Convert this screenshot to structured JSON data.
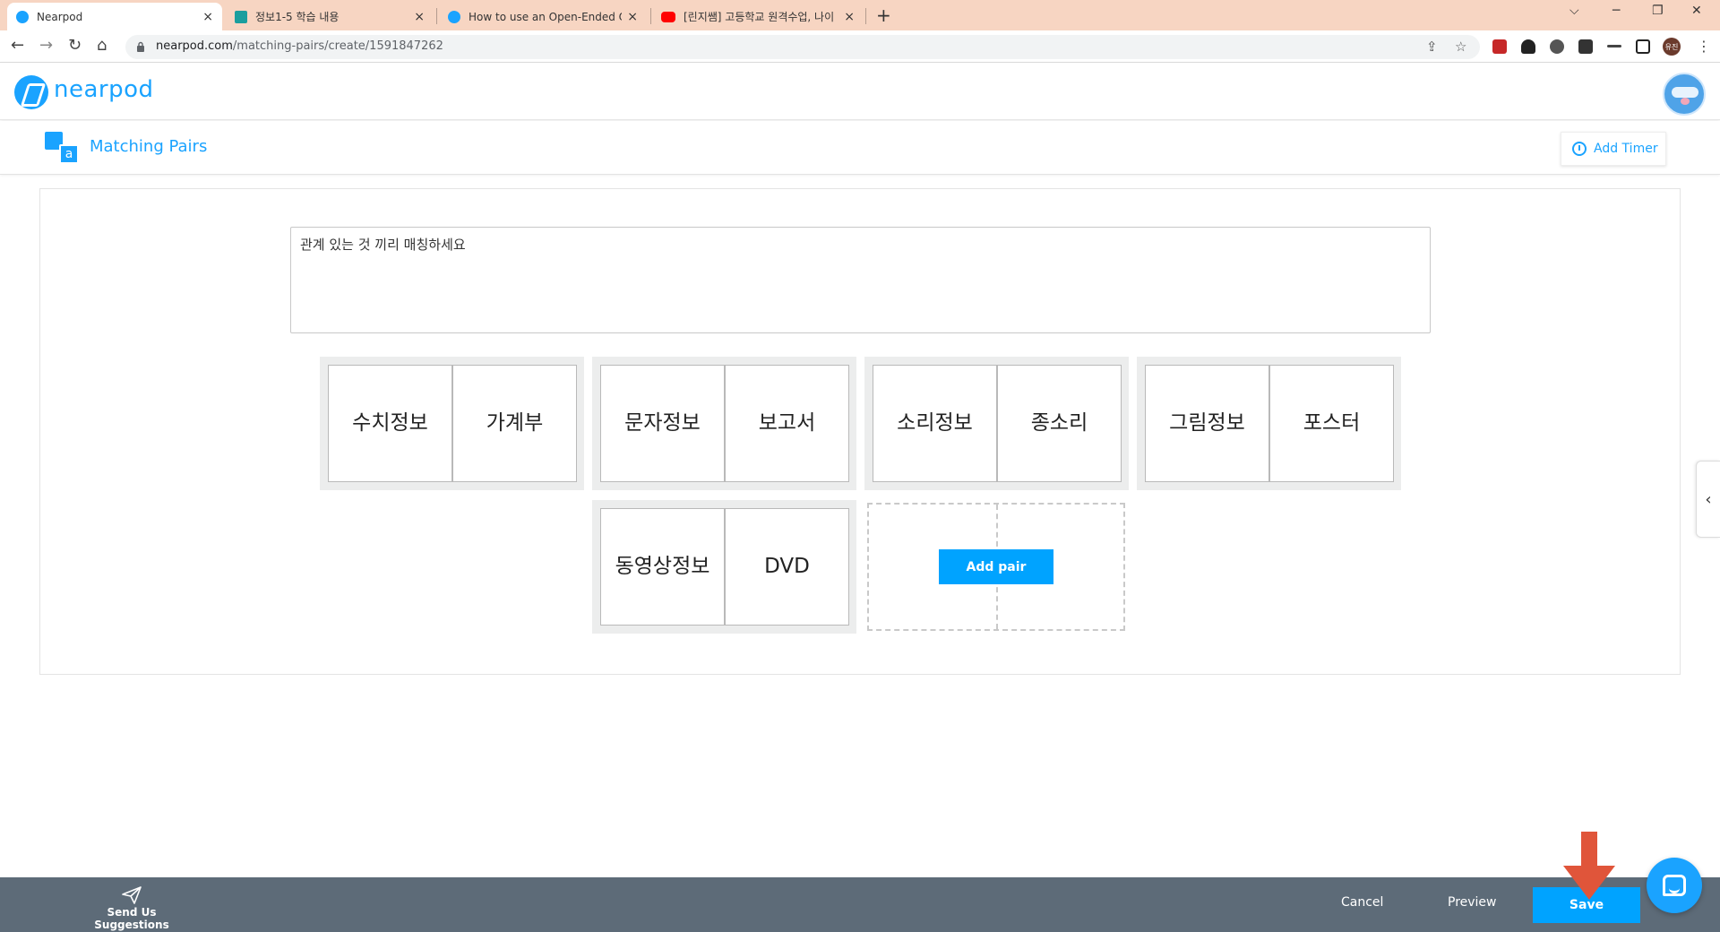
{
  "browser": {
    "tabs": [
      {
        "title": "Nearpod",
        "close": "×",
        "active": true,
        "favicon": "nearpod-icon"
      },
      {
        "title": "정보1-5 학습 내용",
        "close": "×",
        "active": false,
        "favicon": "classroom-icon"
      },
      {
        "title": "How to use an Open-Ended Qu",
        "close": "×",
        "active": false,
        "favicon": "nearpod-icon"
      },
      {
        "title": "[린지쌤] 고등학교 원격수업, 나이",
        "close": "×",
        "active": false,
        "favicon": "youtube-icon"
      }
    ],
    "new_tab": "+",
    "controls": {
      "dropdown": "⌵",
      "minimize": "─",
      "restore": "❐",
      "close": "✕"
    },
    "nav": {
      "back": "←",
      "forward": "→",
      "reload": "↻",
      "home": "⌂"
    },
    "url_host": "nearpod.com",
    "url_path": "/matching-pairs/create/1591847262",
    "omni_icons": {
      "share": "⇪",
      "star": "☆"
    },
    "profile_initials": "유진",
    "menu": "⋮"
  },
  "app": {
    "logo_text": "nearpod",
    "activity_title": "Matching Pairs",
    "activity_icon_letter": "a",
    "add_timer_label": "Add Timer",
    "question_text": "관계 있는 것 끼리 매칭하세요",
    "pairs": [
      {
        "left": "수치정보",
        "right": "가계부"
      },
      {
        "left": "문자정보",
        "right": "보고서"
      },
      {
        "left": "소리정보",
        "right": "종소리"
      },
      {
        "left": "그림정보",
        "right": "포스터"
      },
      {
        "left": "동영상정보",
        "right": "DVD"
      }
    ],
    "add_pair_label": "Add pair",
    "side_tab_glyph": "‹"
  },
  "footer": {
    "send_suggestions_label": "Send Us Suggestions",
    "cancel_label": "Cancel",
    "preview_label": "Preview",
    "save_label": "Save"
  },
  "colors": {
    "brand_blue": "#1aa3ff",
    "button_blue": "#00a3ff",
    "footer_bg": "#5d6b78",
    "annotation_arrow": "#e0553a",
    "tab_strip": "#f7d5c2"
  }
}
